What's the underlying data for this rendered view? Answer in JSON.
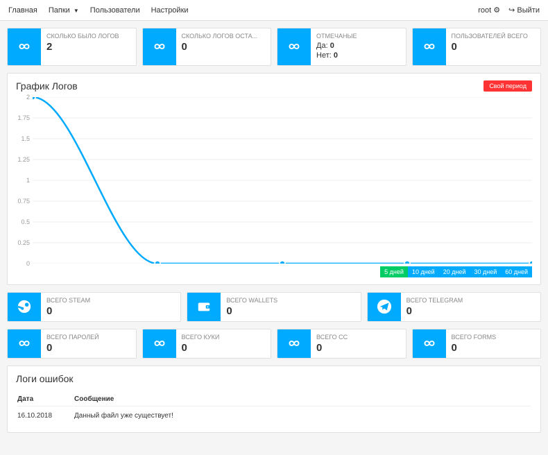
{
  "nav": {
    "items": [
      "Главная",
      "Папки",
      "Пользователи",
      "Настройки"
    ],
    "user": "root",
    "logout": "Выйти"
  },
  "top_cards": [
    {
      "title": "СКОЛЬКО БЫЛО ЛОГОВ",
      "value": "2"
    },
    {
      "title": "СКОЛЬКО ЛОГОВ ОСТА...",
      "value": "0"
    },
    {
      "title": "ОТМЕЧАНЫЕ",
      "yes_label": "Да:",
      "yes": "0",
      "no_label": "Нет:",
      "no": "0"
    },
    {
      "title": "ПОЛЬЗОВАТЕЛЕЙ ВСЕГО",
      "value": "0"
    }
  ],
  "chart": {
    "title": "График Логов",
    "custom_period": "Свой период",
    "periods": [
      "5 дней",
      "10 дней",
      "20 дней",
      "30 дней",
      "60 дней"
    ],
    "y_ticks": [
      "2",
      "1.75",
      "1.5",
      "1.25",
      "1",
      "0.75",
      "0.5",
      "0.25",
      "0"
    ]
  },
  "chart_data": {
    "type": "line",
    "x": [
      0,
      1,
      2,
      3,
      4
    ],
    "values": [
      2,
      0,
      0,
      0,
      0
    ],
    "ylim": [
      0,
      2
    ],
    "title": "График Логов",
    "xlabel": "",
    "ylabel": ""
  },
  "mid_cards": [
    {
      "title": "ВСЕГО STEAM",
      "value": "0",
      "icon": "steam"
    },
    {
      "title": "ВСЕГО WALLETS",
      "value": "0",
      "icon": "wallet"
    },
    {
      "title": "ВСЕГО TELEGRAM",
      "value": "0",
      "icon": "telegram"
    }
  ],
  "bottom_cards": [
    {
      "title": "ВСЕГО ПАРОЛЕЙ",
      "value": "0"
    },
    {
      "title": "ВСЕГО КУКИ",
      "value": "0"
    },
    {
      "title": "ВСЕГО CC",
      "value": "0"
    },
    {
      "title": "ВСЕГО FORMS",
      "value": "0"
    }
  ],
  "logs": {
    "title": "Логи ошибок",
    "headers": {
      "date": "Дата",
      "message": "Сообщение"
    },
    "rows": [
      {
        "date": "16.10.2018",
        "message": "Данный файл уже существует!"
      }
    ]
  }
}
